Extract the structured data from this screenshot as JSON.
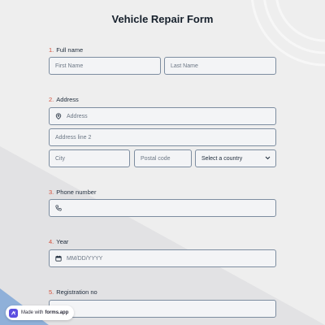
{
  "form": {
    "title": "Vehicle Repair Form",
    "questions": [
      {
        "number": "1.",
        "label": "Full name"
      },
      {
        "number": "2.",
        "label": "Address"
      },
      {
        "number": "3.",
        "label": "Phone number"
      },
      {
        "number": "4.",
        "label": "Year"
      },
      {
        "number": "5.",
        "label": "Registration no"
      }
    ],
    "fields": {
      "first_name_placeholder": "First Name",
      "last_name_placeholder": "Last Name",
      "address_placeholder": "Address",
      "address2_placeholder": "Address line 2",
      "city_placeholder": "City",
      "postal_code_placeholder": "Postal code",
      "country_selected": "Select a country",
      "phone_placeholder": "",
      "date_placeholder": "MM/DD/YYYY",
      "registration_placeholder": ""
    }
  },
  "branding": {
    "made_with": "Made with",
    "brand": "forms.app"
  },
  "colors": {
    "accent_number": "#d5503a",
    "field_border": "#7d8da0",
    "badge_logo": "#5b4ee0"
  },
  "icons": {
    "address": "location-pin-icon",
    "phone": "phone-icon",
    "date": "calendar-icon",
    "select": "chevron-down-icon"
  }
}
